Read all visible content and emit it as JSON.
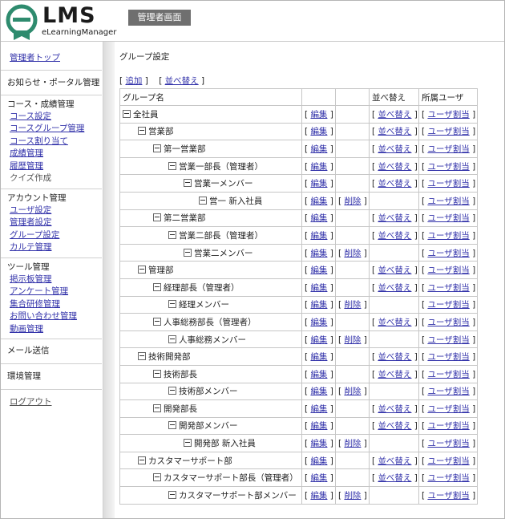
{
  "header": {
    "logo_text": "LMS",
    "logo_sub": "eLearningManager",
    "admin_badge": "管理者画面"
  },
  "sidebar": {
    "top_link": "管理者トップ",
    "news": "お知らせ・ポータル管理",
    "course": {
      "title": "コース・成績管理",
      "items": [
        "コース設定",
        "コースグループ管理",
        "コース割り当て",
        "成績管理",
        "履歴管理",
        "クイズ作成"
      ]
    },
    "account": {
      "title": "アカウント管理",
      "items": [
        "ユーザ設定",
        "管理者設定",
        "グループ設定",
        "カルテ管理"
      ]
    },
    "tools": {
      "title": "ツール管理",
      "items": [
        "掲示板管理",
        "アンケート管理",
        "集合研修管理",
        "お問い合わせ管理",
        "動画管理"
      ]
    },
    "mail": "メール送信",
    "env": "環境管理",
    "logout": "ログアウト"
  },
  "main": {
    "title": "グループ設定",
    "add_label": "追加",
    "sort_label": "並べ替え",
    "headers": {
      "name": "グループ名",
      "col2": "",
      "col3": "",
      "sort": "並べ替え",
      "users": "所属ユーザ"
    },
    "edit_label": "編集",
    "delete_label": "削除",
    "sort_link": "並べ替え",
    "user_link": "ユーザ割当",
    "rows": [
      {
        "name": "全社員",
        "level": 0,
        "delete": false,
        "sort": true
      },
      {
        "name": "営業部",
        "level": 1,
        "delete": false,
        "sort": true
      },
      {
        "name": "第一営業部",
        "level": 2,
        "delete": false,
        "sort": true
      },
      {
        "name": "営業一部長（管理者）",
        "level": 3,
        "delete": false,
        "sort": true
      },
      {
        "name": "営業一メンバー",
        "level": 4,
        "delete": false,
        "sort": true
      },
      {
        "name": "営一 新入社員",
        "level": 5,
        "delete": true,
        "sort": false
      },
      {
        "name": "第二営業部",
        "level": 2,
        "delete": false,
        "sort": true
      },
      {
        "name": "営業二部長（管理者）",
        "level": 3,
        "delete": false,
        "sort": true
      },
      {
        "name": "営業二メンバー",
        "level": 4,
        "delete": true,
        "sort": false
      },
      {
        "name": "管理部",
        "level": 1,
        "delete": false,
        "sort": true
      },
      {
        "name": "経理部長（管理者）",
        "level": 2,
        "delete": false,
        "sort": true
      },
      {
        "name": "経理メンバー",
        "level": 3,
        "delete": true,
        "sort": false
      },
      {
        "name": "人事総務部長（管理者）",
        "level": 2,
        "delete": false,
        "sort": true
      },
      {
        "name": "人事総務メンバー",
        "level": 3,
        "delete": true,
        "sort": false
      },
      {
        "name": "技術開発部",
        "level": 1,
        "delete": false,
        "sort": true
      },
      {
        "name": "技術部長",
        "level": 2,
        "delete": false,
        "sort": true
      },
      {
        "name": "技術部メンバー",
        "level": 3,
        "delete": true,
        "sort": false
      },
      {
        "name": "開発部長",
        "level": 2,
        "delete": false,
        "sort": true
      },
      {
        "name": "開発部メンバー",
        "level": 3,
        "delete": false,
        "sort": true
      },
      {
        "name": "開発部 新入社員",
        "level": 4,
        "delete": true,
        "sort": false
      },
      {
        "name": "カスタマーサポート部",
        "level": 1,
        "delete": false,
        "sort": true
      },
      {
        "name": "カスタマーサポート部長（管理者）",
        "level": 2,
        "delete": false,
        "sort": true
      },
      {
        "name": "カスタマーサポート部メンバー",
        "level": 3,
        "delete": true,
        "sort": false
      }
    ]
  },
  "colors": {
    "link": "#3333aa",
    "badge": "#6f6f6f",
    "logo_green": "#2e8b6e"
  }
}
